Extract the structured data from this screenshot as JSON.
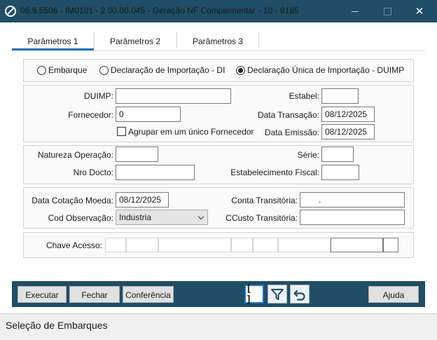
{
  "window": {
    "title": "06.9.5506 - IM0101 - 2.00.00.045 - Geração NF Complementar - 10 - 8185",
    "close_glyph": "✕"
  },
  "tabs": [
    {
      "label": "Parâmetros 1",
      "selected": true
    },
    {
      "label": "Parâmetros 2",
      "selected": false
    },
    {
      "label": "Parâmetros 3",
      "selected": false
    }
  ],
  "import_type": {
    "options": [
      {
        "label": "Embarque",
        "selected": false
      },
      {
        "label": "Declaração de Importação - DI",
        "selected": false
      },
      {
        "label": "Declaração Única de Importação - DUIMP",
        "selected": true
      }
    ]
  },
  "document": {
    "duimp_label": "DUIMP:",
    "duimp_value": "",
    "estabel_label": "Estabel:",
    "estabel_value": "",
    "fornecedor_label": "Fornecedor:",
    "fornecedor_value": "0",
    "data_transacao_label": "Data Transação:",
    "data_transacao_value": "08/12/2025",
    "agrupar_label": "Agrupar em um único Fornecedor",
    "agrupar_checked": false,
    "data_emissao_label": "Data Emissão:",
    "data_emissao_value": "08/12/2025"
  },
  "fiscal": {
    "natureza_label": "Natureza Operação:",
    "natureza_value": "",
    "serie_label": "Série:",
    "serie_value": "",
    "nro_docto_label": "Nro Docto:",
    "nro_docto_value": "",
    "estab_fiscal_label": "Estabelecimento Fiscal:",
    "estab_fiscal_value": ""
  },
  "accounting": {
    "data_cotacao_label": "Data Cotação Moeda:",
    "data_cotacao_value": "08/12/2025",
    "conta_transitoria_label": "Conta Transitória:",
    "conta_transitoria_value": ".",
    "cod_observacao_label": "Cod Observação:",
    "cod_observacao_value": "Industria",
    "ccusto_label": "CCusto Transitória:",
    "ccusto_value": ""
  },
  "access_key": {
    "label": "Chave Acesso:"
  },
  "toolbar": {
    "executar_label": "Executar",
    "fechar_label": "Fechar",
    "conferencia_label": "Conferência",
    "brackets_label": "[ ]",
    "ajuda_label": "Ajuda",
    "bar_color": "#1f4e66",
    "accent_color": "#1e73be"
  },
  "status": {
    "text": "Seleção de Embarques"
  }
}
